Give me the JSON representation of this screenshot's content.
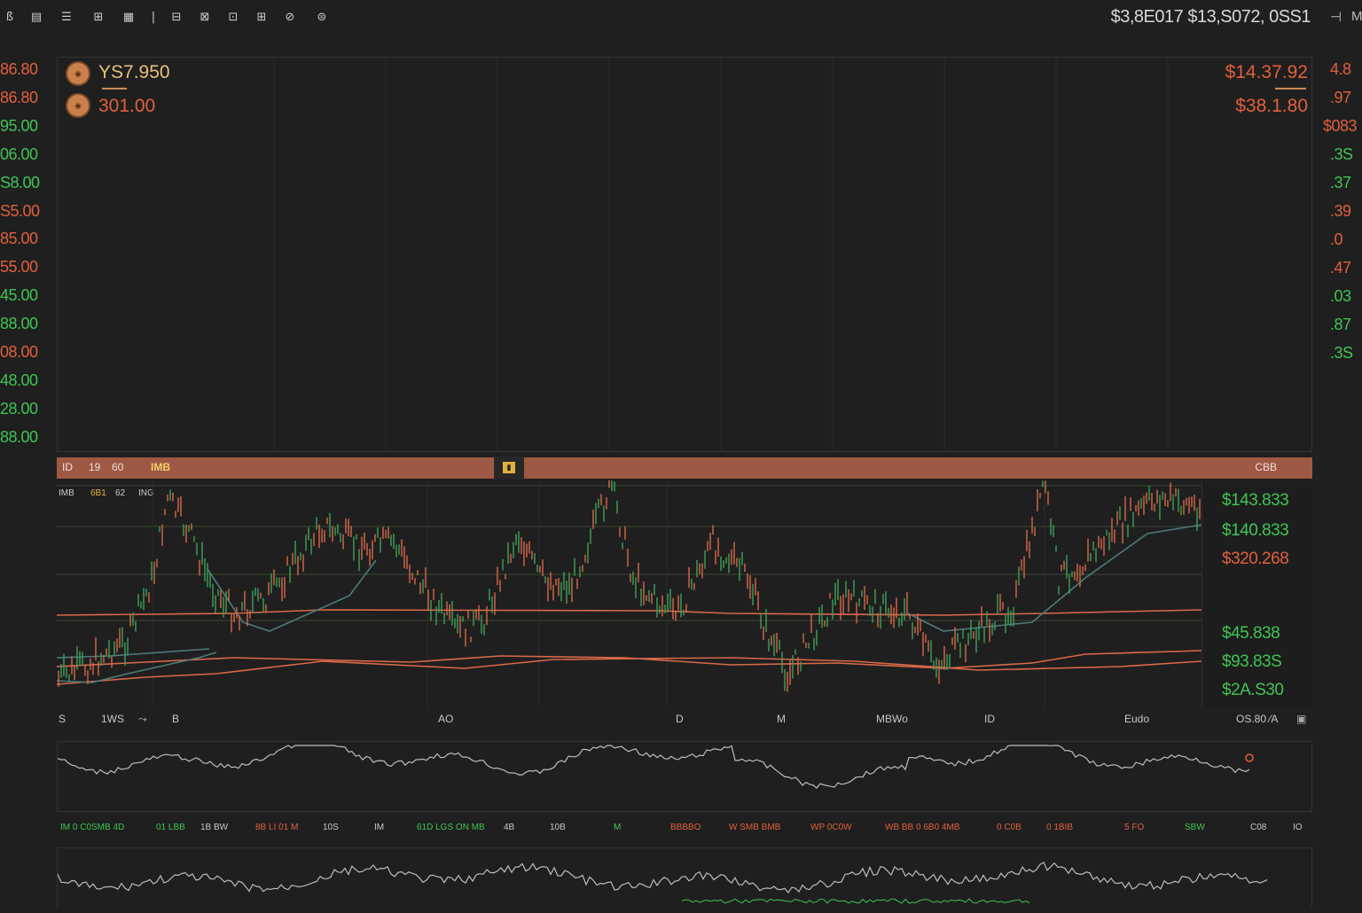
{
  "toolbar": {
    "tools": [
      "ß",
      "▤",
      "☰",
      "⊞",
      "▦",
      "|",
      "⊟",
      "⊠",
      "⊡",
      "⊞",
      "⊘",
      "⊜"
    ],
    "quote": "$3,8E017 $13,S072, 0SS1",
    "ctrl_1": "⊣",
    "ctrl_2": "M"
  },
  "left_axis": [
    {
      "text": "86.80",
      "color": "#e0603c"
    },
    {
      "text": "86.80",
      "color": "#e0603c"
    },
    {
      "text": "95.00",
      "color": "#3fc454"
    },
    {
      "text": "06.00",
      "color": "#3fc454"
    },
    {
      "text": "S8.00",
      "color": "#3fc454"
    },
    {
      "text": "S5.00",
      "color": "#e0603c"
    },
    {
      "text": "85.00",
      "color": "#e0603c"
    },
    {
      "text": "55.00",
      "color": "#e0603c"
    },
    {
      "text": "45.00",
      "color": "#3fc454"
    },
    {
      "text": "88.00",
      "color": "#3fc454"
    },
    {
      "text": "08.00",
      "color": "#e0603c"
    },
    {
      "text": "48.00",
      "color": "#3fc454"
    },
    {
      "text": "28.00",
      "color": "#3fc454"
    },
    {
      "text": "88.00",
      "color": "#3fc454"
    }
  ],
  "right_axis": [
    {
      "text": "4.8",
      "color": "#e0603c"
    },
    {
      "text": ".97",
      "color": "#e0603c"
    },
    {
      "text": "$083",
      "color": "#e0603c"
    },
    {
      "text": ".3S",
      "color": "#3fc454"
    },
    {
      "text": ".37",
      "color": "#3fc454"
    },
    {
      "text": ".39",
      "color": "#e0603c"
    },
    {
      "text": ".0",
      "color": "#e0603c"
    },
    {
      "text": ".47",
      "color": "#e0603c"
    },
    {
      "text": ".03",
      "color": "#3fc454"
    },
    {
      "text": ".87",
      "color": "#3fc454"
    },
    {
      "text": ".3S",
      "color": "#3fc454"
    }
  ],
  "main": {
    "ticker_1": "YS7.950",
    "ticker_1_sub": "▬▬▬▬",
    "ticker_2": "301.00",
    "price_1": "$14.37.92",
    "price_1_sub": "▬▬▬▬▬",
    "price_2": "$38.1.80"
  },
  "band": {
    "items": [
      "ID",
      "19",
      "60",
      "IMB"
    ],
    "right": "CBB"
  },
  "chart_header": [
    "IMB",
    "6B1",
    "62",
    "ING"
  ],
  "price_axis": [
    {
      "text": "$143.833",
      "color": "#3fc454"
    },
    {
      "text": "$140.833",
      "color": "#3fc454"
    },
    {
      "text": "$320.268",
      "color": "#e0603c"
    },
    {
      "text": "$45.838",
      "color": "#3fc454"
    },
    {
      "text": "$93.83S",
      "color": "#3fc454"
    },
    {
      "text": "$2A.S30",
      "color": "#3fc454"
    }
  ],
  "x_axis": [
    "S",
    "1WS",
    "⤳",
    "B",
    "AO",
    "D",
    "M",
    "MBWo",
    "ID",
    "Eudo",
    "OS.80 ⁄A"
  ],
  "legend": [
    {
      "text": "IM 0 C0SMB 4D",
      "color": "#3fc454"
    },
    {
      "text": "01 LBB",
      "color": "#3fc454"
    },
    {
      "text": "1B BW",
      "color": "#c8c8c8"
    },
    {
      "text": "8B LI 01 M",
      "color": "#e0603c"
    },
    {
      "text": "10S",
      "color": "#c8c8c8"
    },
    {
      "text": "IM",
      "color": "#c8c8c8"
    },
    {
      "text": "61D LGS ON MB",
      "color": "#3fc454"
    },
    {
      "text": "4B",
      "color": "#c8c8c8"
    },
    {
      "text": "10B",
      "color": "#c8c8c8"
    },
    {
      "text": "M",
      "color": "#3fc454"
    },
    {
      "text": "BBBBO",
      "color": "#e0603c"
    },
    {
      "text": "W SMB BMB",
      "color": "#e0603c"
    },
    {
      "text": "WP 0C0W",
      "color": "#e0603c"
    },
    {
      "text": "WB BB 0 6B0 4MB",
      "color": "#e0603c"
    },
    {
      "text": "0 C0B",
      "color": "#e0603c"
    },
    {
      "text": "0 1BIB",
      "color": "#e0603c"
    },
    {
      "text": "5 FO",
      "color": "#e0603c"
    },
    {
      "text": "SBW",
      "color": "#3fc454"
    },
    {
      "text": "C08",
      "color": "#c8c8c8"
    },
    {
      "text": "IO",
      "color": "#c8c8c8"
    }
  ]
}
